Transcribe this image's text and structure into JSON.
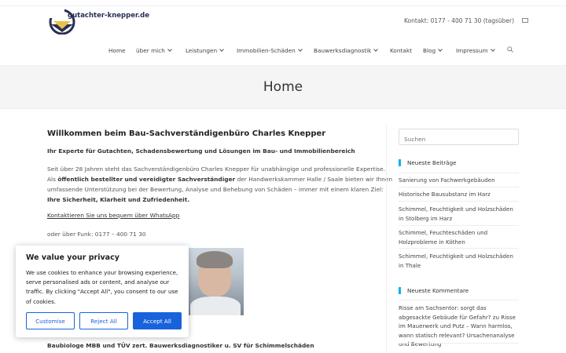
{
  "header": {
    "logo_text": "gutachter-knepper.de",
    "contact": "Kontakt: 0177 - 400 71 30 (tagsüber)"
  },
  "nav": {
    "items": [
      {
        "label": "Home",
        "has_dropdown": false
      },
      {
        "label": "über mich",
        "has_dropdown": true
      },
      {
        "label": "Leistungen",
        "has_dropdown": true
      },
      {
        "label": "Immobilien-Schäden",
        "has_dropdown": true
      },
      {
        "label": "Bauwerksdiagnostik",
        "has_dropdown": true
      },
      {
        "label": "Kontakt",
        "has_dropdown": false
      },
      {
        "label": "Blog",
        "has_dropdown": true
      },
      {
        "label": "Impressum",
        "has_dropdown": true
      }
    ]
  },
  "hero": {
    "title": "Home"
  },
  "main": {
    "welcome": "Willkommen beim Bau-Sachverständigenbüro Charles Knepper",
    "subtitle": "Ihr Experte für Gutachten, Schadensbewertung und Lösungen im Bau- und Immobilienbereich",
    "para_line1": "Seit über 28 Jahren steht das Sachverständigenbüro Charles Knepper für unabhängige und professionelle Expertise.",
    "para_line2_pre": "Als ",
    "para_line2_bold": "öffentlich bestellter und vereidigter Sachverständiger",
    "para_line2_post": " der Handwerkskammer Halle / Saale bieten wir Ihnen",
    "para_line3": "umfassende Unterstützung bei der Bewertung, Analyse und Behebung von Schäden – immer mit einem klaren Ziel:",
    "para_line4": "Ihre Sicherheit, Klarheit und Zufriedenheit.",
    "whatsapp": " Kontaktieren Sie uns bequem über WhatsApp",
    "funk": "oder über Funk: 0177 – 400 71 30",
    "baubio": "Baubiologe MBB und TÜV zert. Bauwerksdiagnostiker u. SV für Schimmelschäden"
  },
  "sidebar": {
    "search_placeholder": "Suchen",
    "recent_posts_title": "Neueste Beiträge",
    "recent_posts": [
      "Sanierung von Fachwerkgebäuden",
      "Historische Bausubstanz im Harz",
      "Schimmel, Feuchtigkeit und Holzschäden in Stolberg im Harz",
      "Schimmel, Feuchteschäden und Holzprobleme in Köthen",
      "Schimmel, Feuchtigkeit und Holzschäden in Thale"
    ],
    "recent_comments_title": "Neueste Kommentare",
    "recent_comment": "Risse am Sachsentor: sorgt das abgesackte Gebäude für Gefahr? zu Risse im Mauerwerk und Putz – Wann harmlos, wann statisch relevant? Ursachenanalyse und Bewertung"
  },
  "cookie": {
    "title": "We value your privacy",
    "text": "We use cookies to enhance your browsing experience, serve personalised ads or content, and analyse our traffic. By clicking \"Accept All\", you consent to our use of cookies.",
    "customise": "Customise",
    "reject": "Reject All",
    "accept": "Accept All"
  },
  "colors": {
    "accent": "#13aff0",
    "cookie_button": "#1863dc"
  }
}
